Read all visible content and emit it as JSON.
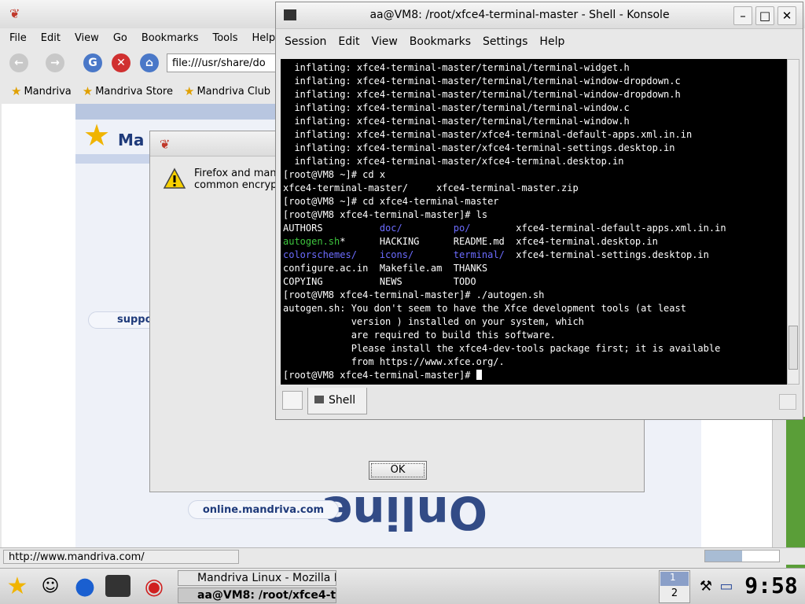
{
  "firefox": {
    "menu": [
      "File",
      "Edit",
      "View",
      "Go",
      "Bookmarks",
      "Tools",
      "Help"
    ],
    "url": "file:///usr/share/do",
    "bookmarks": [
      "Mandriva",
      "Mandriva Store",
      "Mandriva Club"
    ],
    "logo_text": "Ma",
    "support_label": "suppo",
    "online_link": "online.mandriva.com",
    "online_banner": "Online",
    "status_text": "http://www.mandriva.com/",
    "progress": 0.5
  },
  "dialog": {
    "message_line1": "Firefox and man",
    "message_line2": "common encrypt",
    "ok_label": "OK"
  },
  "konsole": {
    "title": "aa@VM8: /root/xfce4-terminal-master - Shell - Konsole",
    "menu": [
      "Session",
      "Edit",
      "View",
      "Bookmarks",
      "Settings",
      "Help"
    ],
    "tab_label": "Shell",
    "lines": [
      "  inflating: xfce4-terminal-master/terminal/terminal-widget.h",
      "  inflating: xfce4-terminal-master/terminal/terminal-window-dropdown.c",
      "  inflating: xfce4-terminal-master/terminal/terminal-window-dropdown.h",
      "  inflating: xfce4-terminal-master/terminal/terminal-window.c",
      "  inflating: xfce4-terminal-master/terminal/terminal-window.h",
      "  inflating: xfce4-terminal-master/xfce4-terminal-default-apps.xml.in.in",
      "  inflating: xfce4-terminal-master/xfce4-terminal-settings.desktop.in",
      "  inflating: xfce4-terminal-master/xfce4-terminal.desktop.in",
      "[root@VM8 ~]# cd x",
      "xfce4-terminal-master/     xfce4-terminal-master.zip",
      "[root@VM8 ~]# cd xfce4-terminal-master",
      "[root@VM8 xfce4-terminal-master]# ls"
    ],
    "ls_rows": [
      [
        {
          "t": "AUTHORS          ",
          "c": ""
        },
        {
          "t": "doc/",
          "c": "blu"
        },
        {
          "t": "         ",
          "c": ""
        },
        {
          "t": "po/",
          "c": "blu"
        },
        {
          "t": "        xfce4-terminal-default-apps.xml.in.in",
          "c": ""
        }
      ],
      [
        {
          "t": "autogen.sh",
          "c": "grn"
        },
        {
          "t": "*      HACKING      README.md  xfce4-terminal.desktop.in",
          "c": ""
        }
      ],
      [
        {
          "t": "colorschemes/",
          "c": "blu"
        },
        {
          "t": "    ",
          "c": ""
        },
        {
          "t": "icons/",
          "c": "blu"
        },
        {
          "t": "       ",
          "c": ""
        },
        {
          "t": "terminal/",
          "c": "blu"
        },
        {
          "t": "  xfce4-terminal-settings.desktop.in",
          "c": ""
        }
      ],
      [
        {
          "t": "configure.ac.in  Makefile.am  THANKS",
          "c": ""
        }
      ],
      [
        {
          "t": "COPYING          NEWS         TODO",
          "c": ""
        }
      ]
    ],
    "lines_after": [
      "[root@VM8 xfce4-terminal-master]# ./autogen.sh",
      "autogen.sh: You don't seem to have the Xfce development tools (at least",
      "            version ) installed on your system, which",
      "            are required to build this software.",
      "            Please install the xfce4-dev-tools package first; it is available",
      "            from https://www.xfce.org/."
    ],
    "prompt": "[root@VM8 xfce4-terminal-master]# "
  },
  "taskbar": {
    "tasks": [
      "Mandriva Linux - Mozilla Fi",
      "aa@VM8: /root/xfce4-tern"
    ],
    "desktop_1": "1",
    "desktop_2": "2",
    "clock": "9:58"
  }
}
